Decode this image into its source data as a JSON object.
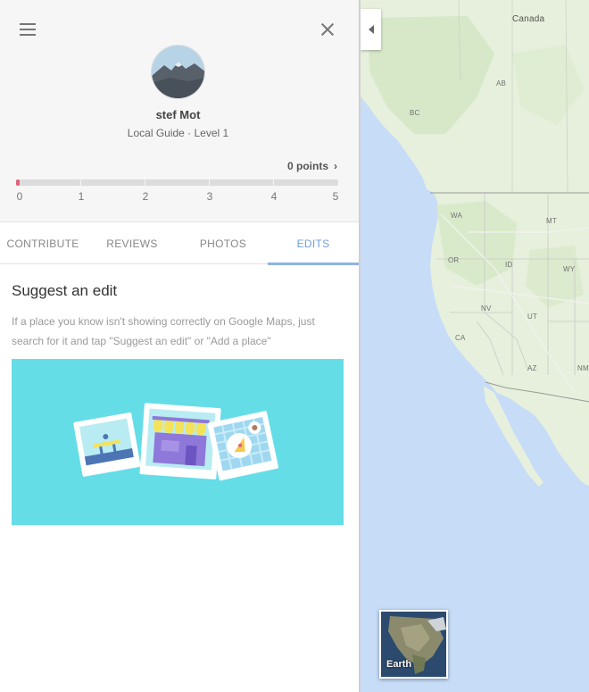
{
  "panel": {
    "user_name": "stef Mot",
    "user_level": "Local Guide · Level 1",
    "points_label": "0 points",
    "points_chevron": "›",
    "progress": {
      "value": 0.01,
      "scale": [
        "0",
        "1",
        "2",
        "3",
        "4",
        "5"
      ],
      "color": "#e2607a"
    }
  },
  "tabs": [
    {
      "label": "CONTRIBUTE",
      "active": false
    },
    {
      "label": "REVIEWS",
      "active": false
    },
    {
      "label": "PHOTOS",
      "active": false
    },
    {
      "label": "EDITS",
      "active": true
    }
  ],
  "content": {
    "title": "Suggest an edit",
    "description": "If a place you know isn't showing correctly on Google Maps, just search for it and tap \"Suggest an edit\" or \"Add a place\""
  },
  "map": {
    "labels": {
      "canada": "Canada",
      "ab": "AB",
      "bc": "BC",
      "wa": "WA",
      "mt": "MT",
      "or": "OR",
      "id": "ID",
      "wy": "WY",
      "nv": "NV",
      "ut": "UT",
      "ca": "CA",
      "az": "AZ",
      "nm": "NM"
    },
    "earth_label": "Earth"
  },
  "colors": {
    "accent": "#6f9fdc",
    "illustration_bg": "#64dde7",
    "ocean": "#c6dcf7",
    "land": "#e8f1df"
  }
}
